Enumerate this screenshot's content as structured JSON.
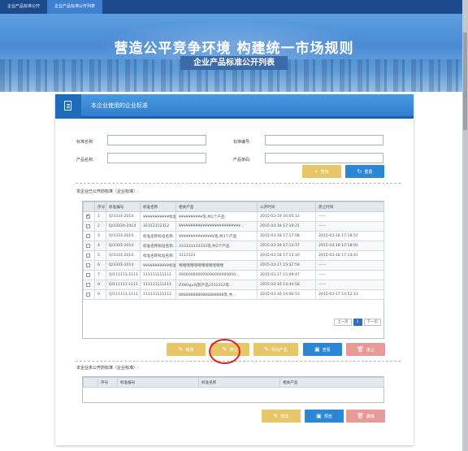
{
  "topnav": {
    "tabs": [
      {
        "label": "企业产品标准公开"
      },
      {
        "label": "企业产品标准公开列表"
      }
    ]
  },
  "banner": {
    "headline": "营造公平竞争环境 构建统一市场规则",
    "subtitle": "企业产品标准公开列表"
  },
  "panel": {
    "title": "本企业使用的企业标准"
  },
  "search": {
    "std_name_label": "标准名称:",
    "std_no_label": "标准编号:",
    "product_name_label": "产品名称:",
    "product_code_label": "产品条码:",
    "query_label": "查询",
    "reset_label": "重置"
  },
  "public_section": {
    "title": "本企业已公开的标准（企业标准）:",
    "columns": [
      "序号",
      "标准编号",
      "标准名称",
      "相关产品",
      "公开时间",
      "废止时间"
    ],
    "rows": [
      {
        "no": "1",
        "std_no": "Q/3333-2014",
        "name": "¥¥¥¥¥¥¥¥¥¥¥标准...",
        "product": "¥¥¥¥¥¥¥¥¥¥等,共2个产品",
        "pub": "2015-03-19 16:05:12",
        "abolish": "——",
        "checked": true
      },
      {
        "no": "2",
        "std_no": "Q/33334-2014",
        "name": "32312312312",
        "product": "¥¥¥¥¥¥¥¥¥¥¥¥¥¥¥¥¥¥¥¥¥¥¥¥¥¥...",
        "pub": "2015-03-18 17:19:21",
        "abolish": "——",
        "checked": false
      },
      {
        "no": "3",
        "std_no": "Q/3333-2014",
        "name": "标准名称标准名称...",
        "product": "¥¥¥¥¥¥¥¥¥¥¥¥¥¥¥等,共3个产品",
        "pub": "2015-03-18 17:17:08",
        "abolish": "2015-03-18 17:18:51",
        "checked": false
      },
      {
        "no": "4",
        "std_no": "Q/3333-2014",
        "name": "标准名称标准名称...",
        "product": "333333333333等,共2个产品",
        "pub": "2015-03-18 17:13:37",
        "abolish": "2015-03-18 17:18:01",
        "checked": false
      },
      {
        "no": "5",
        "std_no": "Q/3333-2014",
        "name": "标准名称标准名称...",
        "product": "3123123",
        "pub": "2015-03-18 17:13:10",
        "abolish": "2015-03-18 17:14:41",
        "checked": false
      },
      {
        "no": "6",
        "std_no": "Q/3333-2014",
        "name": "¥¥¥¥¥¥¥¥¥¥¥标准...",
        "product": "嘿嘿嘿嘿嘿嘿嘿嘿嘿嘿嘿嘿",
        "pub": "2015-03-17 15:37:50",
        "abolish": "——",
        "checked": false
      },
      {
        "no": "7",
        "std_no": "Q/111111-1111",
        "name": "111111111111",
        "product": "000000000000000000000000...",
        "pub": "2015-03-17 15:08:47",
        "abolish": "——",
        "checked": false
      },
      {
        "no": "8",
        "std_no": "Q/111111-1111",
        "name": "111111111111",
        "product": "ZXKOgu光影产品2312312等...",
        "pub": "2015-03-16 14:44:58",
        "abolish": "——",
        "checked": false
      },
      {
        "no": "9",
        "std_no": "Q/111111-1111",
        "name": "111111111111",
        "product": "8888888888888888888等,共...",
        "pub": "2015-03-16 14:06:53",
        "abolish": "2015-03-17 14:52:13",
        "checked": false
      }
    ],
    "pager": {
      "prev": "上一页",
      "current": "1",
      "next": "下一页"
    },
    "buttons": {
      "edit": "修改",
      "revise": "修订",
      "add_product": "添加产品",
      "view": "查看",
      "abolish": "废止"
    }
  },
  "private_section": {
    "title": "本企业未公开的标准（企业标准）:",
    "columns": [
      "序号",
      "标准编号",
      "标准名称",
      "相关产品"
    ],
    "buttons": {
      "edit": "修改",
      "preview": "预览",
      "delete": "删除"
    }
  },
  "colors": {
    "nav": "#1d4a8a",
    "accent": "#2b86d3",
    "warn_button": "#e7c66a",
    "danger_button": "#e79a96",
    "highlight_circle": "#e02222"
  }
}
